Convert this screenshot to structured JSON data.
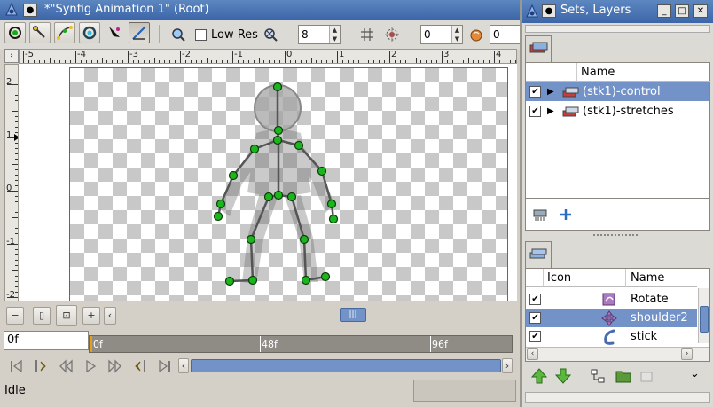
{
  "main_window": {
    "title": "*\"Synfig Animation 1\" (Root)",
    "toolbar": {
      "low_res_label": "Low Res",
      "low_res_checked": false,
      "resolution_value": "8",
      "onion_past_value": "0",
      "onion_future_value": "0"
    },
    "ruler_h_labels": [
      "-5",
      "-4",
      "-3",
      "-2",
      "-1",
      "0",
      "1",
      "2",
      "3",
      "4"
    ],
    "ruler_v_labels": [
      "2",
      "1",
      "0",
      "-1",
      "-2"
    ],
    "time_field": "0f",
    "timebar_labels": [
      "0f",
      "48f",
      "96f"
    ],
    "status_text": "Idle"
  },
  "layers_panel": {
    "title": "Sets, Layers",
    "column_name": "Name",
    "layers": [
      {
        "label": "(stk1)-control",
        "checked": true,
        "selected": true
      },
      {
        "label": "(stk1)-stretches",
        "checked": true,
        "selected": false
      }
    ]
  },
  "library_panel": {
    "columns": {
      "icon": "Icon",
      "name": "Name"
    },
    "items": [
      {
        "label": "Rotate",
        "checked": true,
        "selected": false,
        "icon": "rotate-icon"
      },
      {
        "label": "shoulder2",
        "checked": true,
        "selected": true,
        "icon": "translate-icon"
      },
      {
        "label": "stick",
        "checked": true,
        "selected": false,
        "icon": "stick-icon"
      }
    ]
  },
  "colors": {
    "titlebar": "#4a74b4",
    "selection": "#7393c8",
    "ducks": "#1db51d",
    "timebar": "#8f8c86"
  }
}
